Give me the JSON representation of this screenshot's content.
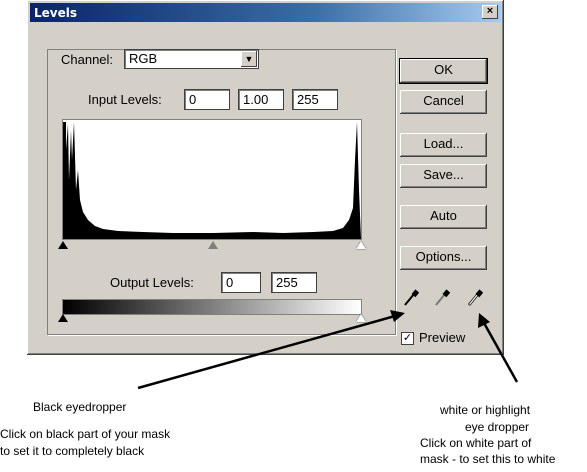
{
  "window": {
    "title": "Levels",
    "close_glyph": "×"
  },
  "channel": {
    "label": "Channel:",
    "value": "RGB",
    "arrow_glyph": "▼"
  },
  "input_levels": {
    "label": "Input Levels:",
    "black": "0",
    "gamma": "1.00",
    "white": "255"
  },
  "output_levels": {
    "label": "Output Levels:",
    "black": "0",
    "white": "255"
  },
  "buttons": {
    "ok": "OK",
    "cancel": "Cancel",
    "load": "Load...",
    "save": "Save...",
    "auto": "Auto",
    "options": "Options..."
  },
  "droppers": {
    "black_icon": "eyedropper-black",
    "gray_icon": "eyedropper-gray",
    "white_icon": "eyedropper-white"
  },
  "preview": {
    "label": "Preview",
    "checked": true,
    "check_glyph": "✓"
  },
  "annotations": {
    "black_title": "Black eyedropper",
    "black_line1": "Click on black part of your mask",
    "black_line2": "to set it to completely black",
    "white_title1": "white or highlight",
    "white_title2": "eye dropper",
    "white_line1": "Click on white part of",
    "white_line2": "mask - to set this to white"
  }
}
